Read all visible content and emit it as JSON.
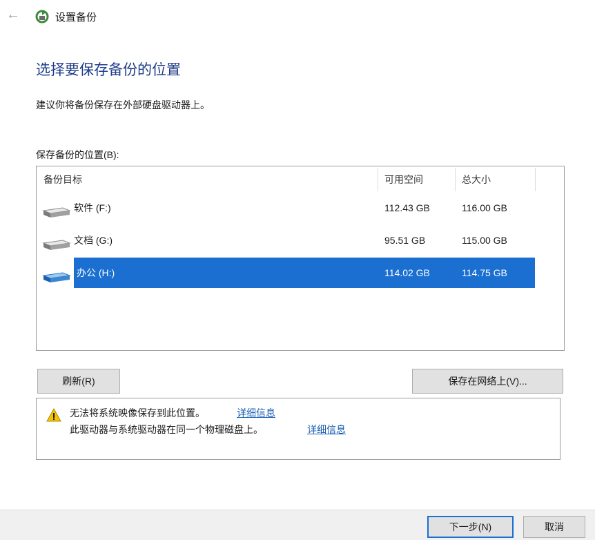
{
  "window": {
    "title": "设置备份"
  },
  "page": {
    "heading": "选择要保存备份的位置",
    "subtitle": "建议你将备份保存在外部硬盘驱动器上。",
    "list_label": "保存备份的位置(B):"
  },
  "table": {
    "columns": [
      "备份目标",
      "可用空间",
      "总大小"
    ],
    "rows": [
      {
        "name": "软件 (F:)",
        "free": "112.43 GB",
        "total": "116.00 GB",
        "selected": false
      },
      {
        "name": "文档 (G:)",
        "free": "95.51 GB",
        "total": "115.00 GB",
        "selected": false
      },
      {
        "name": "办公 (H:)",
        "free": "114.02 GB",
        "total": "114.75 GB",
        "selected": true
      }
    ]
  },
  "buttons": {
    "refresh": "刷新(R)",
    "save_network": "保存在网络上(V)...",
    "next": "下一步(N)",
    "cancel": "取消"
  },
  "warning": {
    "line1": "无法将系统映像保存到此位置。",
    "line2": "此驱动器与系统驱动器在同一个物理磁盘上。",
    "link": "详细信息"
  },
  "colors": {
    "accent": "#1a6fd0",
    "heading": "#1f3d8a",
    "link": "#1a5fb4",
    "warning": "#f5c400"
  },
  "icons": {
    "back": "back-arrow-icon",
    "app": "backup-icon",
    "drive": "drive-icon",
    "warning": "warning-icon"
  }
}
